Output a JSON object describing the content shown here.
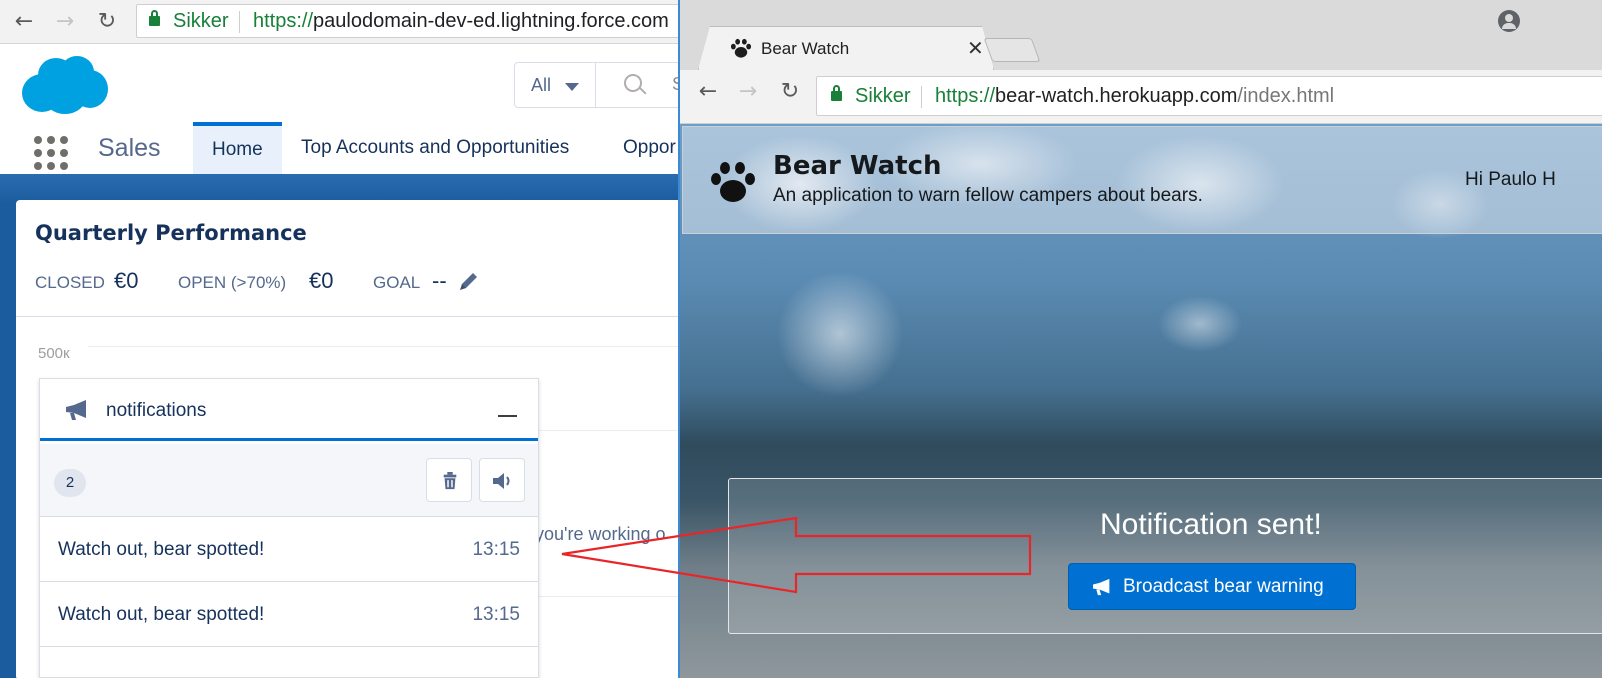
{
  "left_browser": {
    "secure_label": "Sikker",
    "url_scheme": "https://",
    "url_host": "paulodomain-dev-ed.lightning.force.com",
    "icons": [
      "back-icon",
      "forward-icon",
      "reload-icon",
      "lock-icon"
    ]
  },
  "salesforce": {
    "search_scope": "All",
    "search_placeholder": "S",
    "app_name": "Sales",
    "tabs": [
      {
        "label": "Home",
        "active": true
      },
      {
        "label": "Top Accounts and Opportunities",
        "active": false
      },
      {
        "label": "Oppor",
        "active": false
      }
    ],
    "card": {
      "title": "Quarterly Performance",
      "closed_label": "CLOSED",
      "closed_value": "€0",
      "open_label": "OPEN (>70%)",
      "open_value": "€0",
      "goal_label": "GOAL",
      "goal_value": "--",
      "y_tick": "500к",
      "behind_text": "you're working o"
    },
    "brand_color": "#00a1e0",
    "accent_color": "#0070d2"
  },
  "notifications": {
    "title": "notifications",
    "count": "2",
    "items": [
      {
        "message": "Watch out, bear spotted!",
        "time": "13:15"
      },
      {
        "message": "Watch out, bear spotted!",
        "time": "13:15"
      }
    ],
    "icons": [
      "megaphone-icon",
      "minimize-icon",
      "trash-icon",
      "speaker-icon"
    ]
  },
  "right_browser": {
    "tab_title": "Bear Watch",
    "secure_label": "Sikker",
    "url_scheme": "https://",
    "url_host": "bear-watch.herokuapp.com",
    "url_path": "/index.html",
    "icons": [
      "paw-icon",
      "close-icon",
      "new-tab-icon",
      "profile-icon",
      "back-icon",
      "forward-icon",
      "reload-icon",
      "lock-icon"
    ]
  },
  "bear_watch": {
    "title": "Bear Watch",
    "subtitle": "An application to warn fellow campers about bears.",
    "greeting": "Hi Paulo H",
    "status": "Notification sent!",
    "button_label": "Broadcast bear warning",
    "button_color": "#0070d2"
  },
  "annotation": {
    "arrow_color": "#e8262a",
    "arrow_icon": "red-arrow"
  }
}
